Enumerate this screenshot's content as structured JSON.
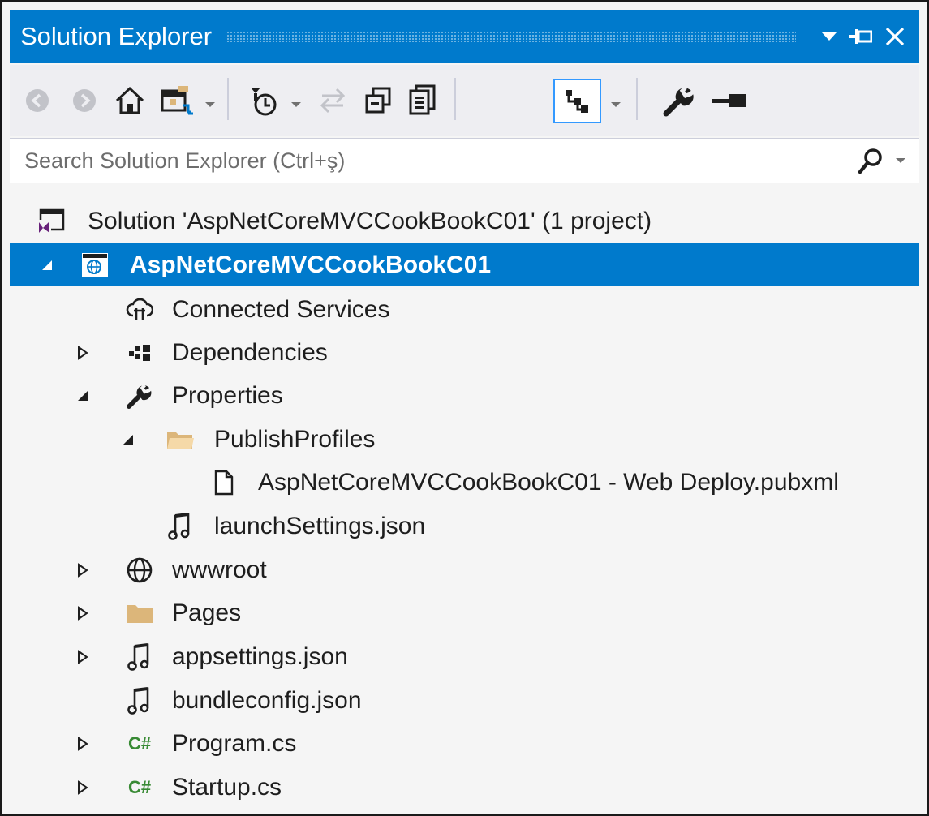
{
  "window": {
    "title": "Solution Explorer"
  },
  "search": {
    "placeholder": "Search Solution Explorer (Ctrl+ş)"
  },
  "toolbar": {
    "icons": [
      "back-icon",
      "forward-icon",
      "home-icon",
      "switch-views-icon",
      "pending-changes-filter-icon",
      "sync-with-active-document-icon",
      "collapse-all-icon",
      "show-all-files-icon",
      "preview-selected-items-icon",
      "properties-icon",
      "pin-icon"
    ]
  },
  "tree": {
    "solution_label": "Solution 'AspNetCoreMVCCookBookC01' (1 project)",
    "project_label": "AspNetCoreMVCCookBookC01",
    "items": [
      {
        "label": "Connected Services",
        "icon": "connected-services-icon"
      },
      {
        "label": "Dependencies",
        "icon": "dependencies-icon"
      },
      {
        "label": "Properties",
        "icon": "wrench-icon"
      },
      {
        "label": "PublishProfiles",
        "icon": "folder-open-icon"
      },
      {
        "label": "AspNetCoreMVCCookBookC01 - Web Deploy.pubxml",
        "icon": "file-icon"
      },
      {
        "label": "launchSettings.json",
        "icon": "json-icon"
      },
      {
        "label": "wwwroot",
        "icon": "globe-icon"
      },
      {
        "label": "Pages",
        "icon": "folder-icon"
      },
      {
        "label": "appsettings.json",
        "icon": "json-icon"
      },
      {
        "label": "bundleconfig.json",
        "icon": "json-icon"
      },
      {
        "label": "Program.cs",
        "icon": "csharp-icon",
        "badge": "C#"
      },
      {
        "label": "Startup.cs",
        "icon": "csharp-icon",
        "badge": "C#"
      }
    ]
  },
  "colors": {
    "accent": "#007acc",
    "panel_bg": "#f5f5f5",
    "toolbar_bg": "#eeeef2",
    "csharp_green": "#388a34",
    "folder_tan": "#dcb67a"
  }
}
